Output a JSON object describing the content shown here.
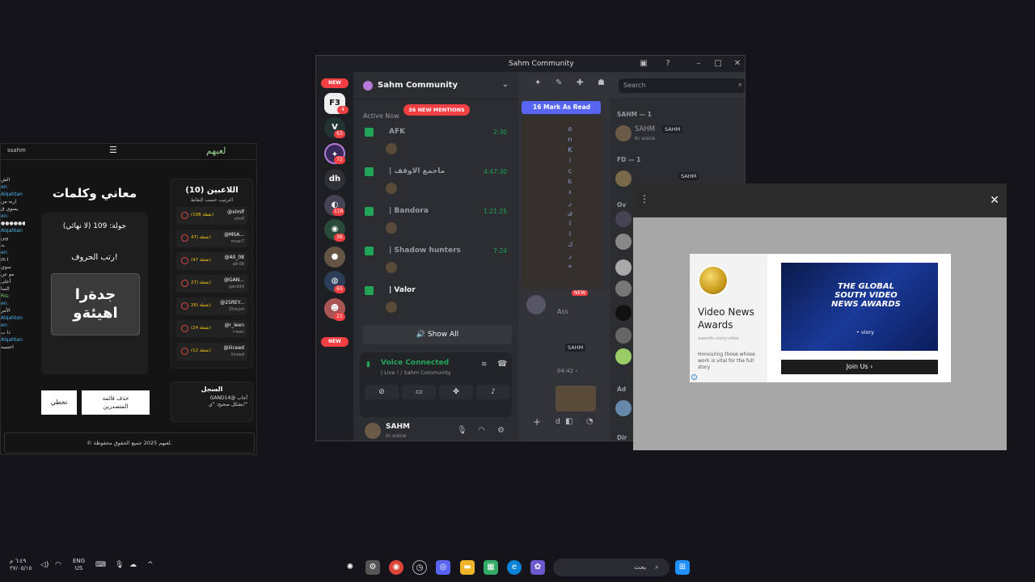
{
  "game": {
    "username": "ssahm",
    "logo": "لعبهم",
    "title": "معاني وكلمات",
    "round": "جولة: 109 (لا نهائي)",
    "hint": "رتب الحروف!",
    "scrambled_line1": "جدةرا",
    "scrambled_line2": "اهيئةو",
    "skip_label": "تخطي",
    "clear_label_line1": "حذف قائمة",
    "clear_label_line2": "المتصدرين",
    "players_title": "اللاعبين (10)",
    "players_subtitle": "الترتيب حسب النقاط",
    "players": [
      {
        "name": "@xlmlf",
        "sub": "xlmlf",
        "points": "(108 نقطة)"
      },
      {
        "name": "@MSA...",
        "sub": "msac7",
        "points": "47) نقطة)"
      },
      {
        "name": "@A0_08",
        "sub": "a9-08",
        "points": "(47 نقطة)"
      },
      {
        "name": "@GAN...",
        "sub": "gand14",
        "points": "27) نقطة)"
      },
      {
        "name": "@25REY...",
        "sub": "25reyof",
        "points": "26) نقطة)"
      },
      {
        "name": "@r_leen",
        "sub": "r-leen",
        "points": "(24 نقطة)"
      },
      {
        "name": "@iiiceed",
        "sub": "iiiceed",
        "points": "(12 نقطة)"
      }
    ],
    "log_title": "السجل",
    "log_text_1": "GAND14@ أجاب",
    "log_text_2": "بشكل صحيح: \"ي!\"",
    "footer": "© لعبهم 2025 جميع الحقوق محفوظة.",
    "left_partial": [
      "الش",
      "en:",
      "Alqahtan",
      "اربه من",
      "يسوي ق",
      "en:",
      "●●●●●●●",
      "Alqahtan",
      "وين",
      "بد",
      "en:",
      "m I",
      "سوي",
      "مو عن",
      "أعلى",
      "السا",
      "Ris:",
      "en:",
      "الأمر",
      "Alqahtan",
      "en:",
      "ذا ب",
      "Alqahtan",
      "احسبه"
    ]
  },
  "discord": {
    "window_title": "Sahm Community",
    "server_name": "Sahm Community",
    "mentions_pill": "36 NEW MENTIONS",
    "active_now": "Active Now",
    "voice_channels": [
      {
        "name": "AFK",
        "time": "2:30"
      },
      {
        "name": "| ماجمع الاوقف",
        "time": "4:47:30"
      },
      {
        "name": "| Bandora",
        "time": "1:21:25"
      },
      {
        "name": "| Shadow hunters",
        "time": "7:24"
      },
      {
        "name": "| Valor",
        "time": ""
      }
    ],
    "show_all": "Show All",
    "voice_connected": "Voice Connected",
    "voice_sub": "| Live ! / Sahm Community",
    "user_name": "SAHM",
    "user_status": "In voice",
    "mark_as_read": "16  Mark As Read",
    "search_placeholder": "Search",
    "vertical_text": [
      "o",
      "n",
      "K",
      "i",
      "c",
      "k",
      "ء",
      "ر",
      "ى",
      "ا",
      "ا",
      "ك",
      "ر",
      "ه"
    ],
    "new_label": "NEW",
    "guild_badges": [
      "4",
      "63",
      "72",
      "116",
      "36",
      "65",
      "21"
    ],
    "guild_dh": "dh",
    "members": {
      "group1": "SAHM — 1",
      "m1_name": "SAHM",
      "m1_tag": "SAHM",
      "m1_sub": "In voice",
      "group2": "FD — 1",
      "m2_tag": "SAHM",
      "partial_ov": "Ov",
      "partial_ad": "Ad",
      "partial_dir": "Dir"
    },
    "chat_partial": {
      "ass": "Ass",
      "tag": "SAHM",
      "time": "04:42 ›"
    }
  },
  "ad": {
    "title": "Video News Awards",
    "url": "awards.viory.video",
    "description": "Honouring those whose work is vital for the full story",
    "banner_title": "THE GLOBAL SOUTH VIDEO NEWS AWARDS",
    "banner_brand": "• viory",
    "join_label": "Join Us ›"
  },
  "taskbar": {
    "time": "٦:٤٩ م",
    "date": "٢٧/٠٥/١٥",
    "lang1": "ENG",
    "lang2": "US",
    "search_placeholder": "بحث"
  }
}
